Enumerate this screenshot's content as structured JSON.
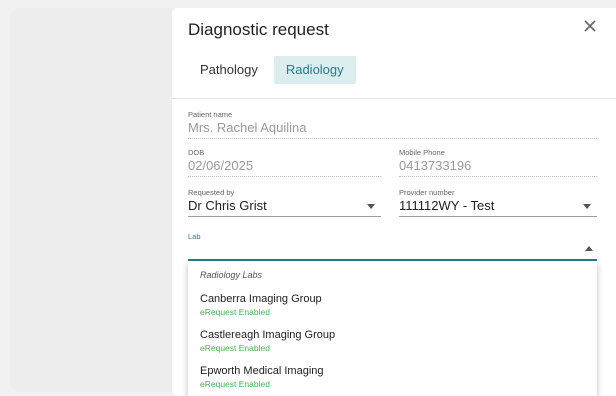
{
  "modal": {
    "title": "Diagnostic request"
  },
  "tabs": [
    {
      "label": "Pathology"
    },
    {
      "label": "Radiology"
    }
  ],
  "fields": {
    "patient_name": {
      "label": "Patient name",
      "value": "Mrs. Rachel Aquilina"
    },
    "dob": {
      "label": "DOB",
      "value": "02/06/2025"
    },
    "mobile": {
      "label": "Mobile Phone",
      "value": "0413733196"
    },
    "requested_by": {
      "label": "Requested by",
      "value": "Dr Chris Grist"
    },
    "provider_number": {
      "label": "Provider number",
      "value": "111112WY - Test"
    },
    "lab": {
      "label": "Lab",
      "value": ""
    }
  },
  "dropdown": {
    "header": "Radiology Labs",
    "items": [
      {
        "name": "Canberra Imaging Group",
        "status": "eRequest Enabled"
      },
      {
        "name": "Castlereagh Imaging Group",
        "status": "eRequest Enabled"
      },
      {
        "name": "Epworth Medical Imaging",
        "status": "eRequest Enabled"
      }
    ]
  },
  "colors": {
    "accent": "#2b7a8c",
    "tab_active_bg": "#dcedf0",
    "enabled_green": "#4caf50"
  },
  "icons": {
    "close": "close-icon",
    "dropdown": "chevron-down-icon",
    "collapse": "chevron-up-icon"
  }
}
